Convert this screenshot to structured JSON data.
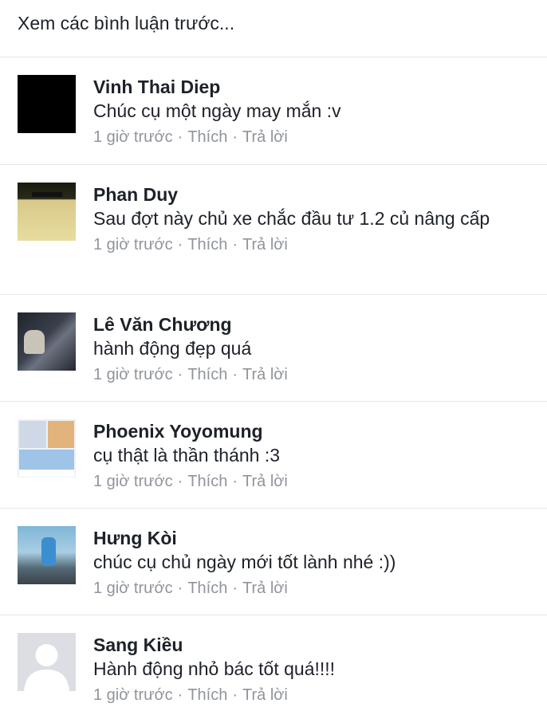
{
  "header": {
    "prev_comments_label": "Xem các bình luận trước..."
  },
  "comments": [
    {
      "name": "Vinh Thai Diep",
      "text": "Chúc cụ một ngày may mắn :v",
      "time": "1 giờ trước",
      "like": "Thích",
      "reply": "Trả lời",
      "avatar": "black-square-avatar"
    },
    {
      "name": "Phan Duy",
      "text": "Sau đợt này chủ xe chắc đầu tư 1.2 củ nâng cấp",
      "time": "1 giờ trước",
      "like": "Thích",
      "reply": "Trả lời",
      "avatar": "photo-avatar"
    },
    {
      "name": "Lê Văn Chương",
      "text": "hành động đẹp quá",
      "time": "1 giờ trước",
      "like": "Thích",
      "reply": "Trả lời",
      "avatar": "photo-avatar"
    },
    {
      "name": "Phoenix Yoyomung",
      "text": "cụ thật là thần thánh :3",
      "time": "1 giờ trước",
      "like": "Thích",
      "reply": "Trả lời",
      "avatar": "comic-avatar"
    },
    {
      "name": "Hưng Kòi",
      "text": "chúc cụ chủ ngày mới tốt lành nhé :))",
      "time": "1 giờ trước",
      "like": "Thích",
      "reply": "Trả lời",
      "avatar": "photo-avatar"
    },
    {
      "name": "Sang Kiều",
      "text": "Hành động nhỏ bác tốt quá!!!!",
      "time": "1 giờ trước",
      "like": "Thích",
      "reply": "Trả lời",
      "avatar": "default-silhouette-avatar"
    }
  ],
  "meta_separator": "·",
  "colors": {
    "name": "#1d2129",
    "meta": "#90949c",
    "divider": "#e5e6e9"
  }
}
